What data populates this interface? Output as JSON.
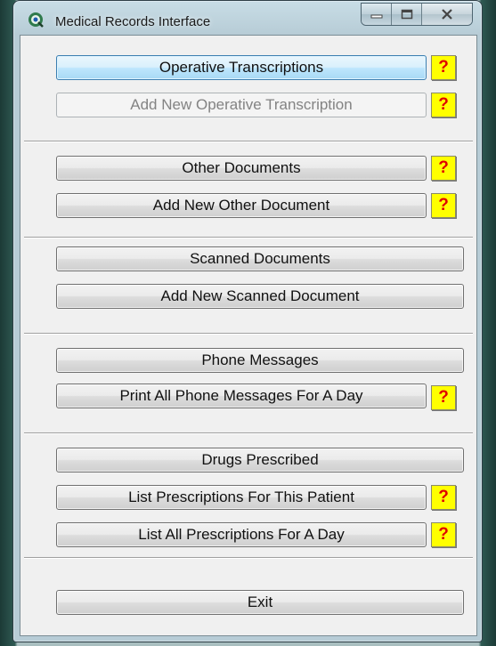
{
  "window": {
    "title": "Medical Records Interface",
    "controls": {
      "minimize": "—",
      "maximize": "□",
      "close": "X"
    }
  },
  "buttons": {
    "operative_transcriptions": "Operative Transcriptions",
    "add_operative_transcription": "Add New Operative Transcription",
    "other_documents": "Other Documents",
    "add_other_document": "Add New Other Document",
    "scanned_documents": "Scanned Documents",
    "add_scanned_document": "Add New Scanned Document",
    "phone_messages": "Phone Messages",
    "print_phone_messages": "Print All Phone Messages For A Day",
    "drugs_prescribed": "Drugs Prescribed",
    "list_prescriptions_patient": "List Prescriptions For This Patient",
    "list_prescriptions_day": "List All Prescriptions For A Day",
    "exit": "Exit"
  },
  "help_glyph": "?",
  "colors": {
    "help_bg": "#ffff00",
    "help_text": "#e00000",
    "focused_button": "#bee6fd"
  },
  "icons": {
    "app": "medical-records-app-icon",
    "help": "help-question-icon"
  }
}
